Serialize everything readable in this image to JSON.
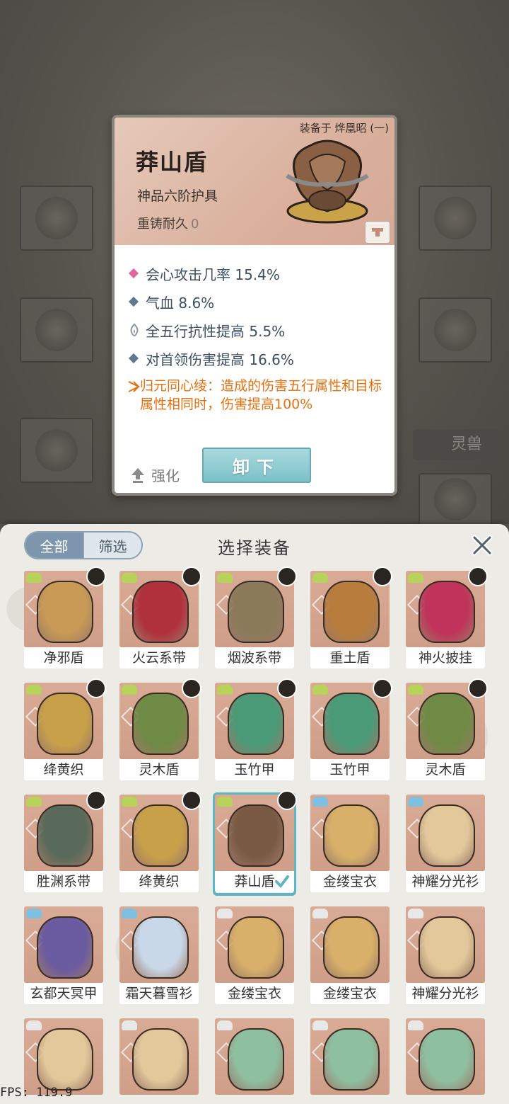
{
  "card": {
    "equipped_on": "装备于 烨凰昭 (一)",
    "item_name": "莽山盾",
    "grade": "神品六阶护具",
    "durability_label": "重铸耐久",
    "durability_value": "0",
    "stats": [
      {
        "text": "会心攻击几率 15.4%",
        "bullet_color": "#e0679b"
      },
      {
        "text": "气血 8.6%",
        "bullet_color": "#5f7891"
      },
      {
        "text": "全五行抗性提高 5.5%",
        "bullet_color": "#8a9aaa"
      },
      {
        "text": "对首领伤害提高 16.6%",
        "bullet_color": "#5f7891"
      }
    ],
    "special": "归元同心绫：造成的伤害五行属性和目标属性相同时，伤害提高100%",
    "enhance_label": "强化",
    "unequip_label": "卸下"
  },
  "background": {
    "spirit_beast_label": "灵兽"
  },
  "sheet": {
    "tab_all": "全部",
    "tab_filter": "筛选",
    "title": "选择装备",
    "items": [
      {
        "name": "净邪盾",
        "art": "#c79a55",
        "slot": "#b8d35a",
        "avatar": true
      },
      {
        "name": "火云系带",
        "art": "#b0303c",
        "slot": "#b8d35a",
        "avatar": true
      },
      {
        "name": "烟波系带",
        "art": "#8a7a5a",
        "slot": "#b8d35a",
        "avatar": true
      },
      {
        "name": "重土盾",
        "art": "#b87d3c",
        "slot": "#b8d35a",
        "avatar": true
      },
      {
        "name": "神火披挂",
        "art": "#c0335a",
        "slot": "#b8d35a",
        "avatar": true
      },
      {
        "name": "绛黄织",
        "art": "#c9a04a",
        "slot": "#b8d35a",
        "avatar": true
      },
      {
        "name": "灵木盾",
        "art": "#6f8a45",
        "slot": "#b8d35a",
        "avatar": true
      },
      {
        "name": "玉竹甲",
        "art": "#4a9a78",
        "slot": "#b8d35a",
        "avatar": true
      },
      {
        "name": "玉竹甲",
        "art": "#4a9a78",
        "slot": "#b8d35a",
        "avatar": true
      },
      {
        "name": "灵木盾",
        "art": "#6f8a45",
        "slot": "#b8d35a",
        "avatar": true
      },
      {
        "name": "胜渊系带",
        "art": "#5a6a5a",
        "slot": "#b8d35a",
        "avatar": true
      },
      {
        "name": "绛黄织",
        "art": "#c9a04a",
        "slot": "#b8d35a",
        "avatar": true
      },
      {
        "name": "莽山盾",
        "art": "#7a5a45",
        "slot": "#b8d35a",
        "avatar": true,
        "selected": true
      },
      {
        "name": "金缕宝衣",
        "art": "#d8b06a",
        "slot": "#7fbfe0",
        "avatar": false
      },
      {
        "name": "神耀分光衫",
        "art": "#e2c89a",
        "slot": "#7fbfe0",
        "avatar": false
      },
      {
        "name": "玄都天冥甲",
        "art": "#6a5aa0",
        "slot": "#7fbfe0",
        "avatar": false
      },
      {
        "name": "霜天暮雪衫",
        "art": "#c8d8e8",
        "slot": "#7fbfe0",
        "avatar": false
      },
      {
        "name": "金缕宝衣",
        "art": "#d8b06a",
        "slot": "#e8e8e8",
        "avatar": false
      },
      {
        "name": "金缕宝衣",
        "art": "#d8b06a",
        "slot": "#e8e8e8",
        "avatar": false
      },
      {
        "name": "神耀分光衫",
        "art": "#e2c89a",
        "slot": "#e8e8e8",
        "avatar": false
      },
      {
        "name": "",
        "art": "#e2c89a",
        "slot": "#e8e8e8",
        "avatar": false
      },
      {
        "name": "",
        "art": "#e2c89a",
        "slot": "#e8e8e8",
        "avatar": false
      },
      {
        "name": "",
        "art": "#8ec0a0",
        "slot": "#e8e8e8",
        "avatar": false
      },
      {
        "name": "",
        "art": "#8ec0a0",
        "slot": "#e8e8e8",
        "avatar": false
      },
      {
        "name": "",
        "art": "#8ec0a0",
        "slot": "#e8e8e8",
        "avatar": false
      }
    ]
  },
  "fps": "FPS: 119.9"
}
